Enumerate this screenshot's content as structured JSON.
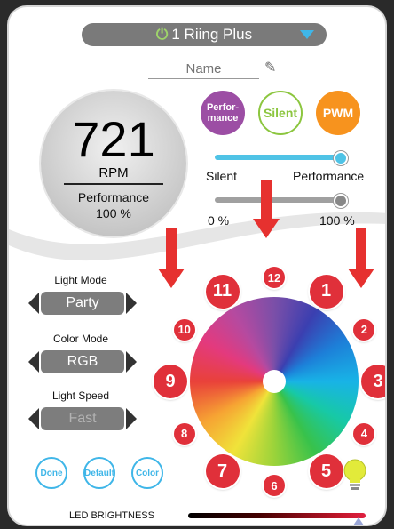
{
  "device": {
    "number": "1",
    "name": "Riing Plus",
    "power_icon": "power-icon",
    "dropdown_icon": "caret-down-icon"
  },
  "name_field": {
    "placeholder": "Name",
    "icon": "pencil-icon"
  },
  "fan": {
    "rpm": "721",
    "rpm_unit": "RPM",
    "mode": "Performance",
    "percent": "100 %"
  },
  "modes": {
    "performance": "Perfor-\nmance",
    "silent": "Silent",
    "pwm": "PWM"
  },
  "speed_slider": {
    "left_label": "Silent",
    "right_label": "Performance",
    "level": 1.0
  },
  "percent_slider": {
    "left_label": "0 %",
    "right_label": "100 %",
    "level": 1.0
  },
  "light_mode": {
    "label": "Light Mode",
    "value": "Party"
  },
  "color_mode": {
    "label": "Color Mode",
    "value": "RGB"
  },
  "light_speed": {
    "label": "Light Speed",
    "value": "Fast"
  },
  "buttons": {
    "done": "Done",
    "default": "Default",
    "color": "Color"
  },
  "zones": [
    "1",
    "2",
    "3",
    "4",
    "5",
    "6",
    "7",
    "8",
    "9",
    "10",
    "11",
    "12"
  ],
  "led": {
    "label": "LED BRIGHTNESS",
    "level": 0.92
  },
  "colors": {
    "accent": "#3fb6e8",
    "zone_red": "#e0303a",
    "arrow_red": "#e6312f",
    "performance": "#9c4ea4",
    "silent": "#8cc63f",
    "pwm": "#f7931e"
  }
}
